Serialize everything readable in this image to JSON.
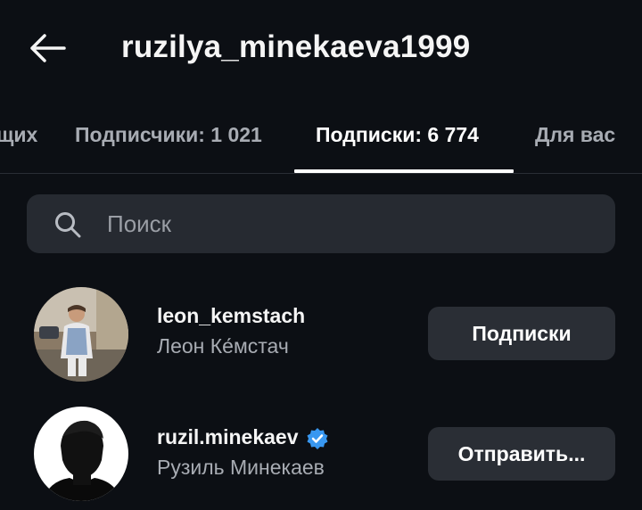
{
  "header": {
    "back_icon": "arrow-left-icon",
    "title": "ruzilya_minekaeva1999"
  },
  "tabs": [
    {
      "label": "щих"
    },
    {
      "label": "Подписчики: 1 021"
    },
    {
      "label": "Подписки: 6 774",
      "active": true
    },
    {
      "label": "Для вас"
    }
  ],
  "search": {
    "icon": "search-icon",
    "placeholder": "Поиск"
  },
  "accounts": [
    {
      "username": "leon_kemstach",
      "full_name": "Леон Ке́мстач",
      "verified": false,
      "button_label": "Подписки"
    },
    {
      "username": "ruzil.minekaev",
      "full_name": "Рузиль Минекаев",
      "verified": true,
      "button_label": "Отправить..."
    }
  ],
  "colors": {
    "background": "#0c0f14",
    "surface": "#262a31",
    "button": "#2a2e35",
    "muted_text": "#a8acb3",
    "verified_badge": "#3897f0"
  }
}
